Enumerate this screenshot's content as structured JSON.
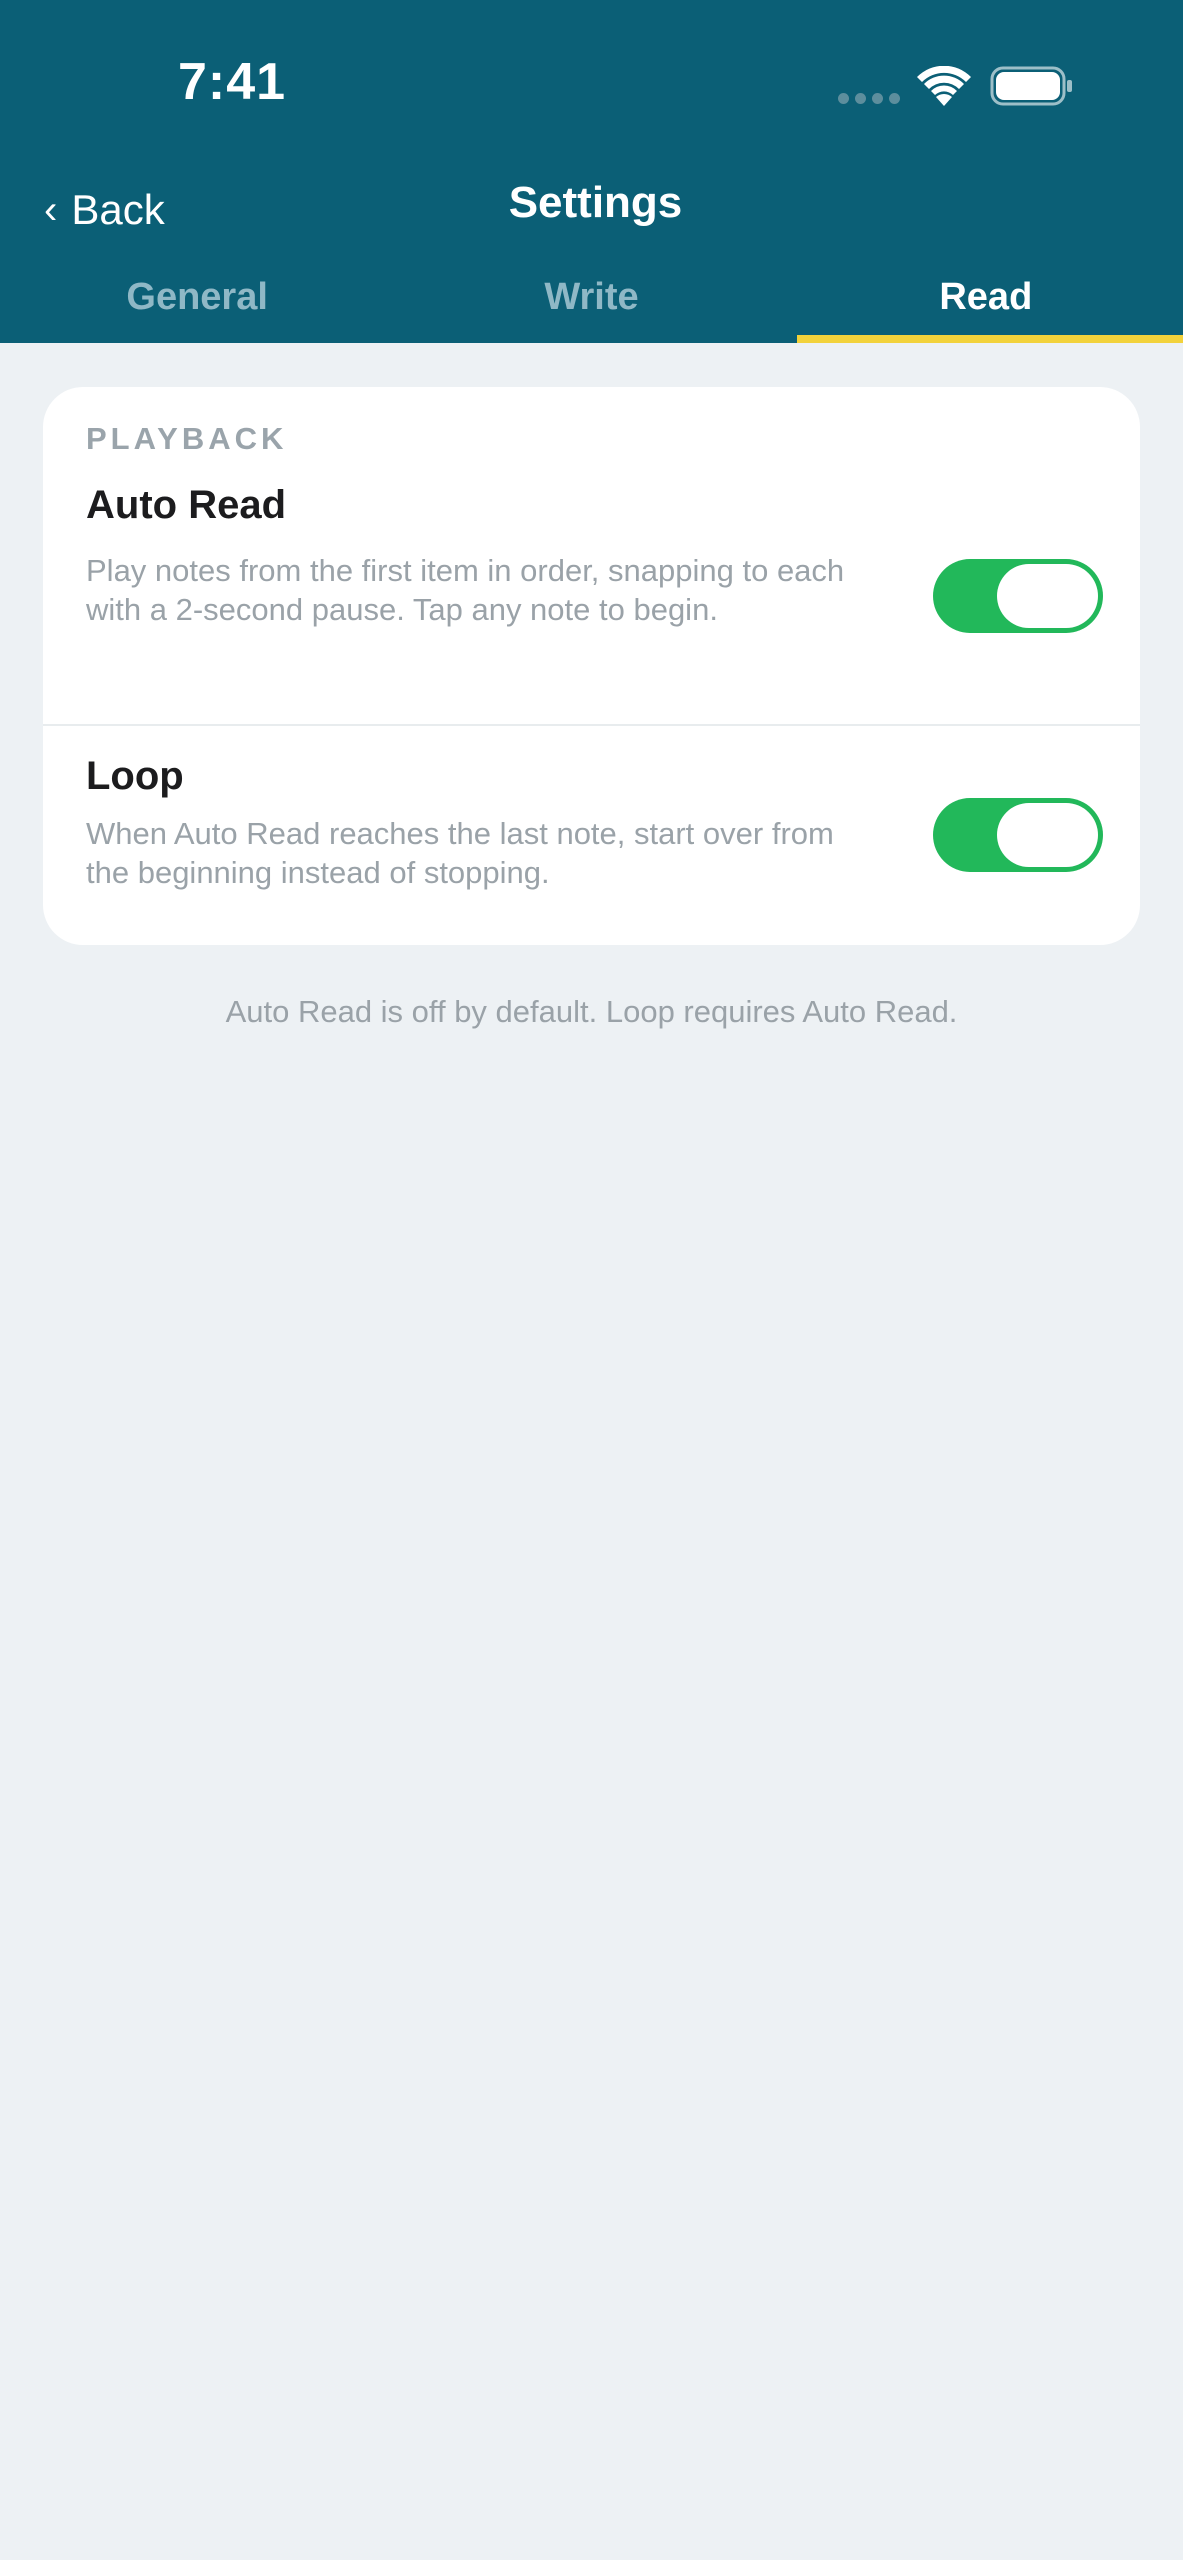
{
  "status_bar": {
    "time": "7:41",
    "signal_icon": "cellular-signal-icon",
    "wifi_icon": "wifi-icon",
    "battery_icon": "battery-icon"
  },
  "nav": {
    "back_label": "Back",
    "back_chevron": "‹",
    "title": "Settings"
  },
  "tabs": [
    {
      "label": "General",
      "active": false
    },
    {
      "label": "Write",
      "active": false
    },
    {
      "label": "Read",
      "active": true
    }
  ],
  "playback": {
    "section_label": "PLAYBACK",
    "items": [
      {
        "title": "Auto Read",
        "description": "Play notes from the first item in order, snapping to each with a 2-second pause. Tap any note to begin.",
        "enabled": true
      },
      {
        "title": "Loop",
        "description": "When Auto Read reaches the last note, start over from the beginning instead of stopping.",
        "enabled": true
      }
    ]
  },
  "footer_note": "Auto Read is off by default. Loop requires Auto Read.",
  "colors": {
    "header": "#0b5f76",
    "tab_indicator": "#f2d23b",
    "toggle_on": "#22b85a",
    "background": "#edf1f4"
  }
}
